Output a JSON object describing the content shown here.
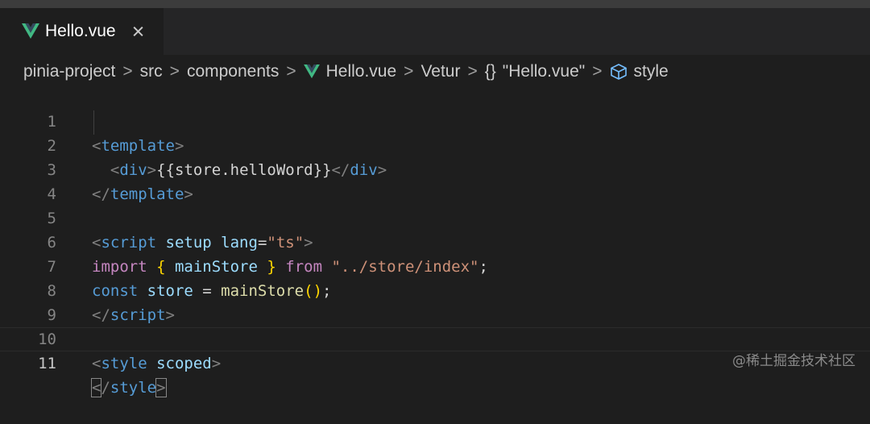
{
  "tab": {
    "label": "Hello.vue",
    "close": "×"
  },
  "breadcrumb": {
    "items": [
      "pinia-project",
      "src",
      "components",
      "Hello.vue",
      "Vetur",
      "{}",
      "\"Hello.vue\"",
      "style"
    ],
    "separator": ">"
  },
  "editor": {
    "line_numbers": [
      "1",
      "2",
      "3",
      "4",
      "5",
      "6",
      "7",
      "8",
      "9",
      "10",
      "11"
    ],
    "active_line": "11",
    "code": {
      "l1_lt": "<",
      "l1_tag": "template",
      "l1_gt": ">",
      "l2_indent": "  ",
      "l2_lt": "<",
      "l2_tag": "div",
      "l2_gt": ">",
      "l2_expr": "{{store.helloWord}}",
      "l2_clt": "</",
      "l2_ctag": "div",
      "l2_cgt": ">",
      "l3_lt": "</",
      "l3_tag": "template",
      "l3_gt": ">",
      "l5_lt": "<",
      "l5_tag": "script",
      "l5_attr1": " setup",
      "l5_attr2": " lang",
      "l5_eq": "=",
      "l5_val": "\"ts\"",
      "l5_gt": ">",
      "l6_import": "import",
      "l6_ob": " {",
      "l6_name": " mainStore",
      "l6_cb": " }",
      "l6_from": " from",
      "l6_path": " \"../store/index\"",
      "l6_semi": ";",
      "l7_const": "const",
      "l7_var": " store",
      "l7_eq": " = ",
      "l7_fn": "mainStore",
      "l7_parens": "()",
      "l7_semi": ";",
      "l8_lt": "</",
      "l8_tag": "script",
      "l8_gt": ">",
      "l10_lt": "<",
      "l10_tag": "style",
      "l10_attr": " scoped",
      "l10_gt": ">",
      "l11_lt": "<",
      "l11_slash": "/",
      "l11_tag": "style",
      "l11_gt": ">"
    }
  },
  "watermark": "@稀土掘金技术社区",
  "colors": {
    "background": "#1e1e1e",
    "tag": "#569cd6",
    "attr": "#9cdcfe",
    "string": "#ce9178",
    "keyword": "#c586c0",
    "function": "#dcdcaa",
    "brace": "#ffd700",
    "vue_green": "#41b883",
    "vue_dark": "#34495e"
  },
  "icons": {
    "tab": "vue-icon",
    "close": "close-icon",
    "style": "cube-icon"
  }
}
